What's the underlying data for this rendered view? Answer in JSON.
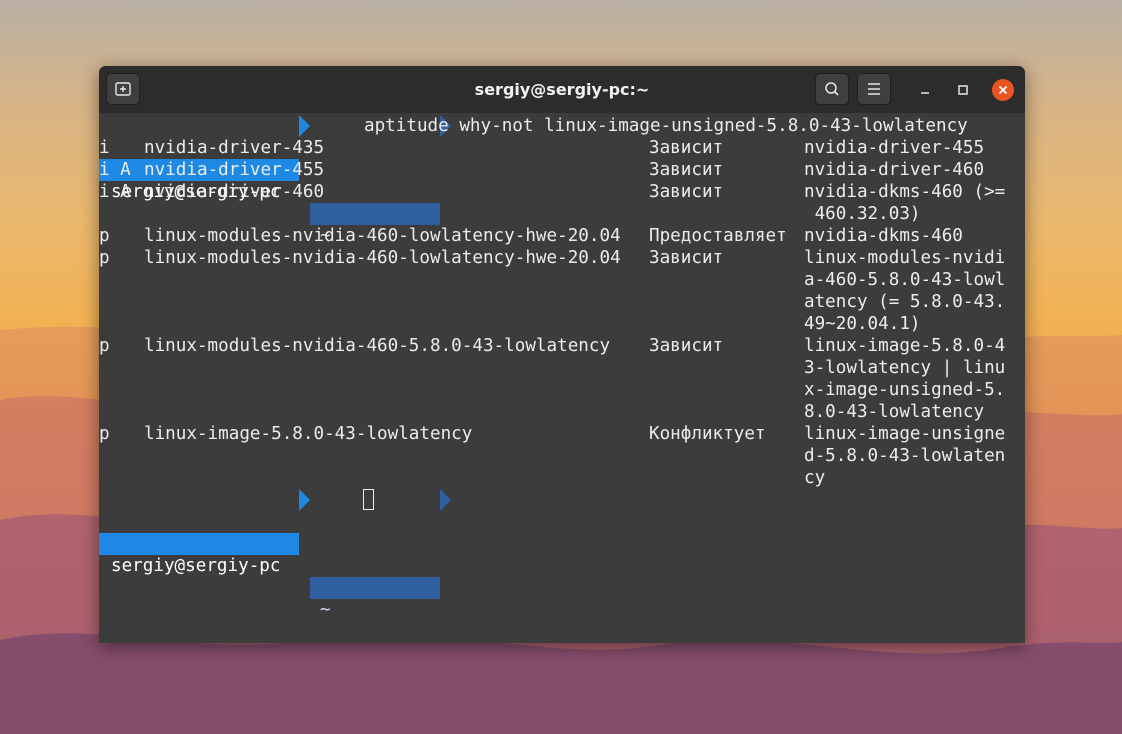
{
  "window": {
    "title": "sergiy@sergiy-pc:~",
    "new_tab_icon": "new-tab-icon",
    "search_icon": "search-icon",
    "menu_icon": "hamburger-menu-icon",
    "minimize_icon": "minimize-icon",
    "maximize_icon": "maximize-icon",
    "close_icon": "close-icon",
    "close_color": "#e95420"
  },
  "prompt": {
    "user_host": "sergiy@sergiy-pc",
    "dir": "~",
    "command": "aptitude why-not linux-image-unsigned-5.8.0-43-lowlatency",
    "primary_color": "#1e88e5",
    "secondary_color": "#2f5f9f"
  },
  "output": {
    "rows": [
      [
        "i  ",
        "nvidia-driver-435",
        "Зависит",
        "nvidia-driver-455"
      ],
      [
        "i A",
        "nvidia-driver-455",
        "Зависит",
        "nvidia-driver-460"
      ],
      [
        "i A",
        "nvidia-driver-460",
        "Зависит",
        "nvidia-dkms-460 (>="
      ],
      [
        "",
        "",
        "",
        " 460.32.03)"
      ],
      [
        "p  ",
        "linux-modules-nvidia-460-lowlatency-hwe-20.04",
        "Предоставляет",
        "nvidia-dkms-460"
      ],
      [
        "p  ",
        "linux-modules-nvidia-460-lowlatency-hwe-20.04",
        "Зависит",
        "linux-modules-nvidi"
      ],
      [
        "",
        "",
        "",
        "a-460-5.8.0-43-lowl"
      ],
      [
        "",
        "",
        "",
        "atency (= 5.8.0-43."
      ],
      [
        "",
        "",
        "",
        "49~20.04.1)"
      ],
      [
        "p  ",
        "linux-modules-nvidia-460-5.8.0-43-lowlatency",
        "Зависит",
        "linux-image-5.8.0-4"
      ],
      [
        "",
        "",
        "",
        "3-lowlatency | linu"
      ],
      [
        "",
        "",
        "",
        "x-image-unsigned-5."
      ],
      [
        "",
        "",
        "",
        "8.0-43-lowlatency"
      ],
      [
        "p  ",
        "linux-image-5.8.0-43-lowlatency",
        "Конфликтует",
        "linux-image-unsigne"
      ],
      [
        "",
        "",
        "",
        "d-5.8.0-43-lowlaten"
      ],
      [
        "",
        "",
        "",
        "cy"
      ]
    ]
  },
  "prompt2": {
    "user_host": "sergiy@sergiy-pc",
    "dir": "~"
  }
}
